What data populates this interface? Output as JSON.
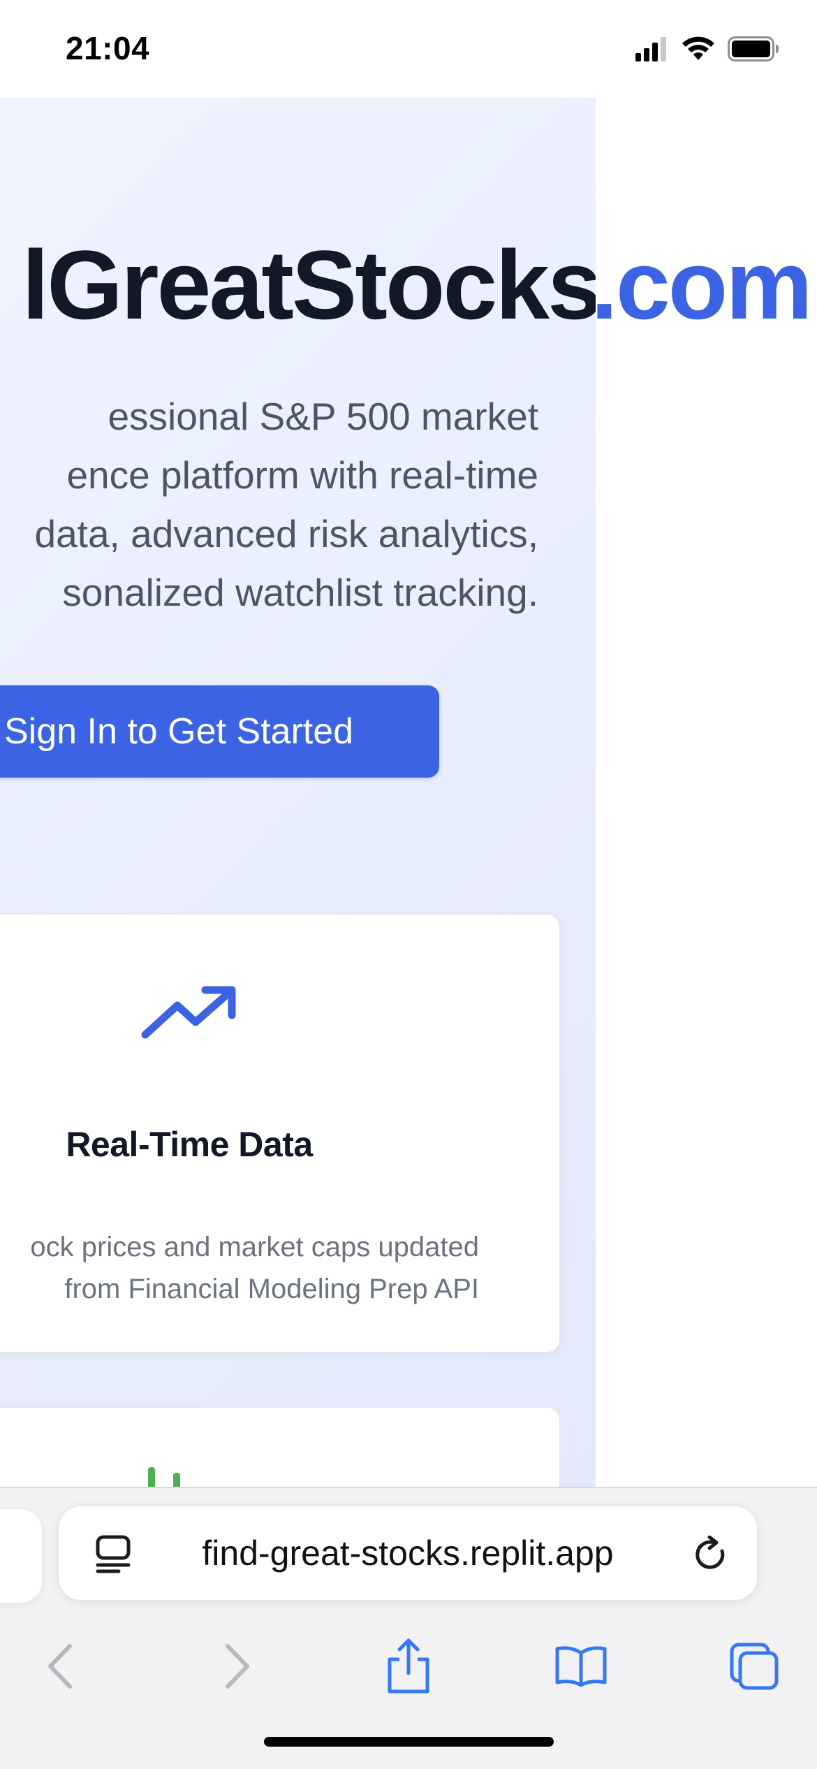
{
  "status_bar": {
    "time": "21:04",
    "icons": [
      "cellular-signal-icon",
      "wifi-icon",
      "battery-icon"
    ]
  },
  "hero": {
    "title_main": "lGreatStocks",
    "title_tld": ".com",
    "description_lines": [
      "essional S&P 500 market",
      "ence platform with real-time",
      "data, advanced risk analytics,",
      "sonalized watchlist tracking."
    ],
    "cta_label": "Sign In to Get Started"
  },
  "features": [
    {
      "icon": "trending-up-icon",
      "title": "Real-Time Data",
      "description_lines": [
        "ock prices and market caps updated",
        "from Financial Modeling Prep API"
      ]
    },
    {
      "icon": "bar-chart-icon"
    }
  ],
  "safari": {
    "url": "find-great-stocks.replit.app",
    "icons": [
      "reader-icon",
      "reload-icon",
      "back-icon",
      "forward-icon",
      "share-icon",
      "bookmarks-icon",
      "tabs-icon"
    ]
  },
  "colors": {
    "accent": "#3b63e3",
    "title_dark": "#111827",
    "text_gray": "#4b5563",
    "background_tint": "#e8edfd"
  }
}
